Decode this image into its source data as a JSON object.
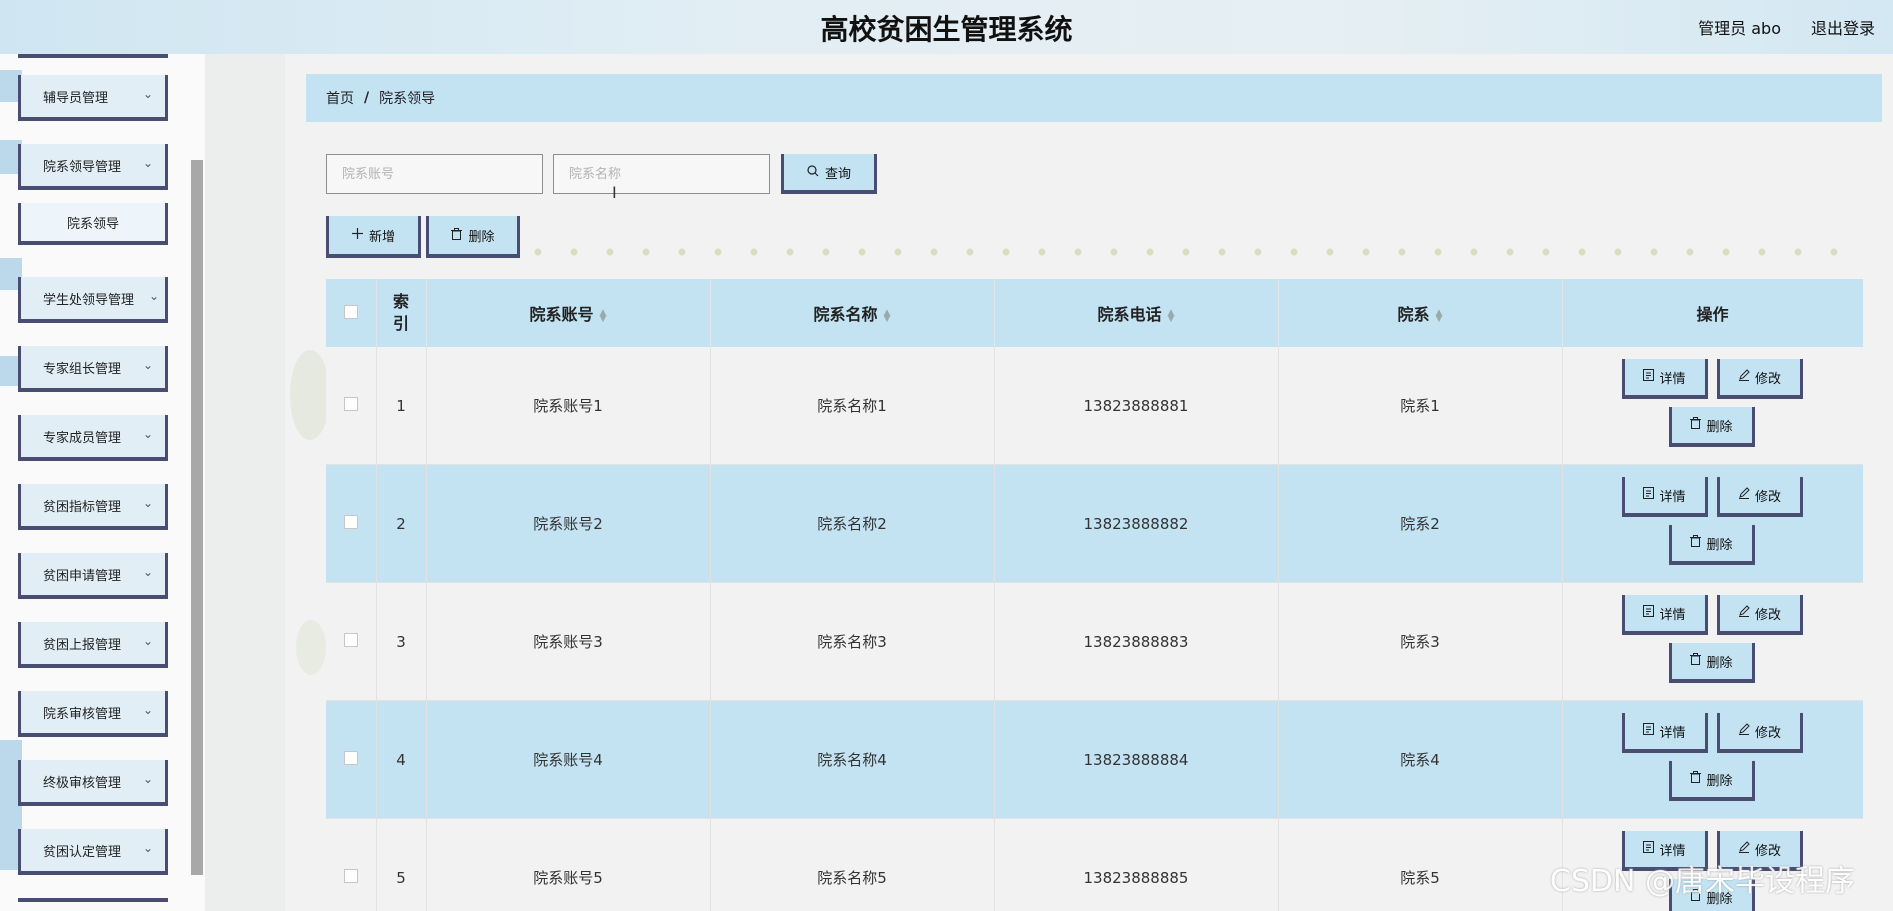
{
  "header": {
    "title": "高校贫困生管理系统",
    "user": "管理员 abo",
    "logout": "退出登录"
  },
  "sidebar": {
    "items": [
      {
        "label": "辅导员管理"
      },
      {
        "label": "院系领导管理"
      },
      {
        "label": "学生处领导管理"
      },
      {
        "label": "专家组长管理"
      },
      {
        "label": "专家成员管理"
      },
      {
        "label": "贫困指标管理"
      },
      {
        "label": "贫困申请管理"
      },
      {
        "label": "贫困上报管理"
      },
      {
        "label": "院系审核管理"
      },
      {
        "label": "终极审核管理"
      },
      {
        "label": "贫困认定管理"
      }
    ],
    "sub_item": "院系领导",
    "chevron": "⌄"
  },
  "breadcrumb": {
    "home": "首页",
    "separator": "/",
    "current": "院系领导"
  },
  "search": {
    "account_placeholder": "院系账号",
    "name_placeholder": "院系名称",
    "query_label": "查询"
  },
  "actions": {
    "add_label": "新增",
    "delete_label": "删除"
  },
  "table": {
    "columns": [
      "索引",
      "院系账号",
      "院系名称",
      "院系电话",
      "院系",
      "操作"
    ],
    "rows": [
      {
        "index": "1",
        "account": "院系账号1",
        "name": "院系名称1",
        "phone": "13823888881",
        "dept": "院系1"
      },
      {
        "index": "2",
        "account": "院系账号2",
        "name": "院系名称2",
        "phone": "13823888882",
        "dept": "院系2"
      },
      {
        "index": "3",
        "account": "院系账号3",
        "name": "院系名称3",
        "phone": "13823888883",
        "dept": "院系3"
      },
      {
        "index": "4",
        "account": "院系账号4",
        "name": "院系名称4",
        "phone": "13823888884",
        "dept": "院系4"
      },
      {
        "index": "5",
        "account": "院系账号5",
        "name": "院系名称5",
        "phone": "13823888885",
        "dept": "院系5"
      }
    ],
    "row_actions": {
      "detail": "详情",
      "edit": "修改",
      "delete": "删除"
    }
  },
  "watermark": "CSDN @唐宋毕设程序",
  "colors": {
    "accent_blue": "#c3e3f3",
    "border_dark": "#4a4d72",
    "header_bg": "#d8ebf4"
  }
}
